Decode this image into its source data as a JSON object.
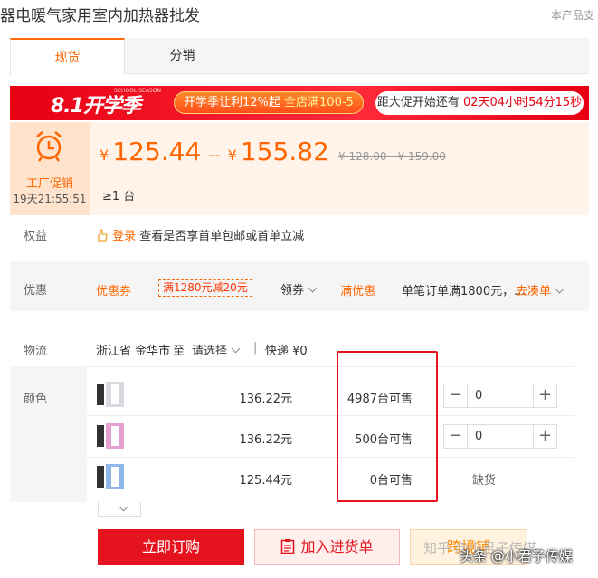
{
  "title": "器电暖气家用室内加热器批发",
  "corner_note": "本产品支",
  "tabs": [
    {
      "label": "现货"
    },
    {
      "label": "分销"
    }
  ],
  "banner": {
    "brand": "8.1开学季",
    "brand_sub": "SCHOOL SEASON",
    "promo_prefix": "开学季让利12%起 ",
    "promo_highlight": "全店满100-5",
    "countdown_prefix": "距大促开始还有 ",
    "countdown_value": "02天04小时54分15秒"
  },
  "factory": {
    "label": "工厂促销",
    "timer": "19天21:55:51"
  },
  "price": {
    "currency": "¥",
    "low": "125.44",
    "separator": "--",
    "high": "155.82",
    "old_low": "¥ 128.00",
    "old_sep": "-",
    "old_high": "¥ 159.00",
    "min_qty": "≥1 台"
  },
  "rights": {
    "label": "权益",
    "login": "登录",
    "text": "查看是否享首单包邮或首单立减"
  },
  "discount": {
    "label": "优惠",
    "coupon": "优惠券",
    "coupon_tag": "满1280元减20元",
    "claim": "领券",
    "full_off": "满优惠",
    "full_off_text": "单笔订单满1800元，...",
    "go_order": "去凑单"
  },
  "logistics": {
    "label": "物流",
    "from": "浙江省 金华市",
    "to_word": "至",
    "to_select": "请选择",
    "express": "快递 ¥0"
  },
  "colors": {
    "label": "颜色",
    "items": [
      {
        "price": "136.22元",
        "stock": "4987台可售",
        "qty": "0",
        "color": "#d9d9e0"
      },
      {
        "price": "136.22元",
        "stock": "500台可售",
        "qty": "0",
        "color": "#e7a1d0"
      },
      {
        "price": "125.44元",
        "stock": "0台可售",
        "soldout": "缺货",
        "color": "#8fb6e8"
      }
    ]
  },
  "buttons": {
    "order": "立即订购",
    "cart": "加入进货单",
    "third": "跨境铺"
  },
  "watermark": "知乎 @小君子传媒",
  "credit": "头条 @小君子传媒",
  "theme": {
    "orange": "#ff6600",
    "red": "#e5131d"
  }
}
